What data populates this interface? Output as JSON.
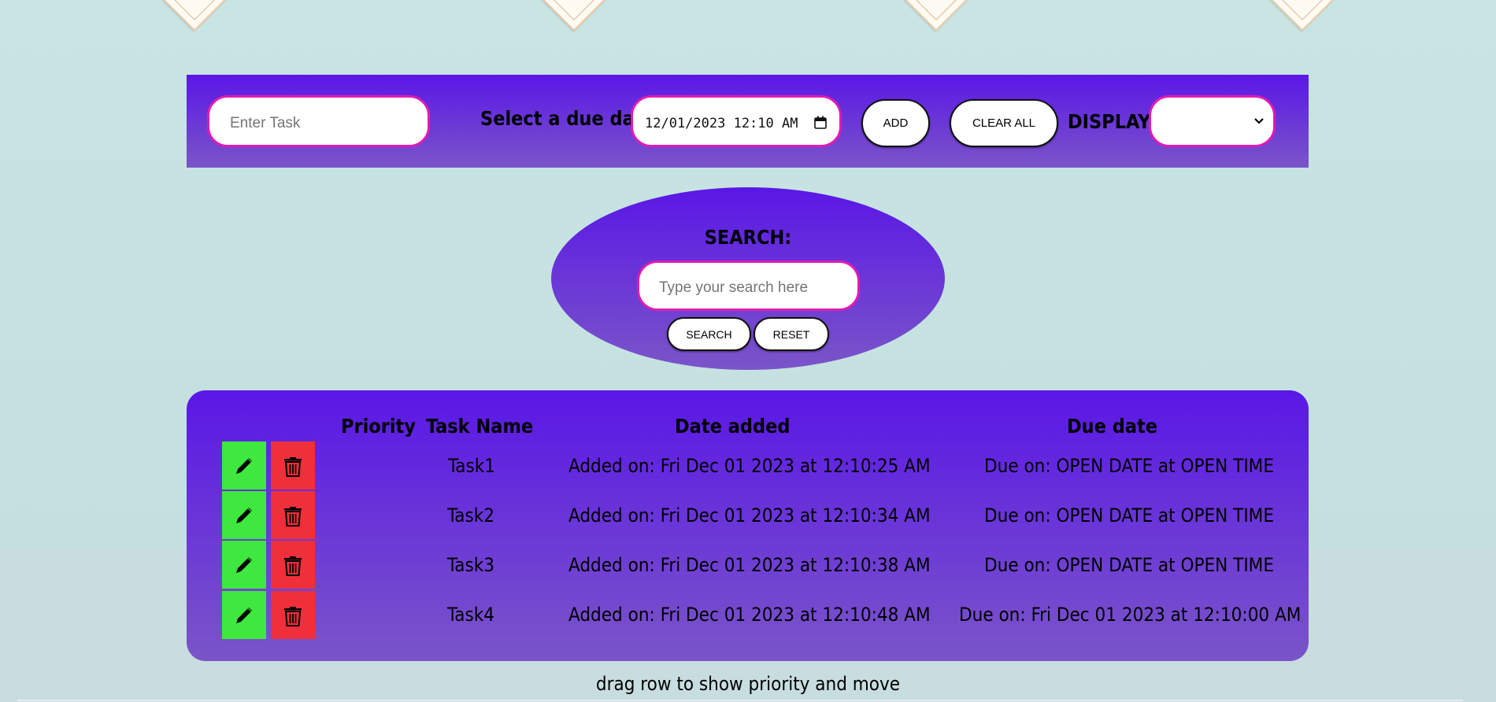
{
  "toolbar": {
    "task_placeholder": "Enter Task",
    "due_label": "Select a due date:",
    "due_value": "12/01/2023 12:10 AM",
    "add_label": "ADD",
    "clear_label": "CLEAR ALL",
    "display_label": "DISPLAY:",
    "display_selected": ""
  },
  "search": {
    "title": "SEARCH:",
    "placeholder": "Type your search here",
    "search_label": "SEARCH",
    "reset_label": "RESET"
  },
  "table": {
    "headers": {
      "priority": "Priority",
      "task_name": "Task Name",
      "date_added": "Date added",
      "due_date": "Due date"
    },
    "rows": [
      {
        "name": "Task1",
        "added": "Added on: Fri Dec 01 2023 at 12:10:25 AM",
        "due": "Due on: OPEN DATE at OPEN TIME"
      },
      {
        "name": "Task2",
        "added": "Added on: Fri Dec 01 2023 at 12:10:34 AM",
        "due": "Due on: OPEN DATE at OPEN TIME"
      },
      {
        "name": "Task3",
        "added": "Added on: Fri Dec 01 2023 at 12:10:38 AM",
        "due": "Due on: OPEN DATE at OPEN TIME"
      },
      {
        "name": "Task4",
        "added": "Added on: Fri Dec 01 2023 at 12:10:48 AM",
        "due": "Due on: Fri Dec 01 2023 at 12:10:00 AM"
      }
    ]
  },
  "footer": {
    "hint": "drag row to show priority and move"
  },
  "icons": {
    "edit": "pencil-icon",
    "delete": "trash-icon",
    "calendar": "calendar-icon",
    "dropdown": "chevron-down-icon"
  },
  "colors": {
    "accent": "#5a17e6",
    "input_border": "#e01bb4",
    "edit_button": "#3ee83e",
    "delete_button": "#ef2f3a",
    "background": "#c8e4e3"
  }
}
